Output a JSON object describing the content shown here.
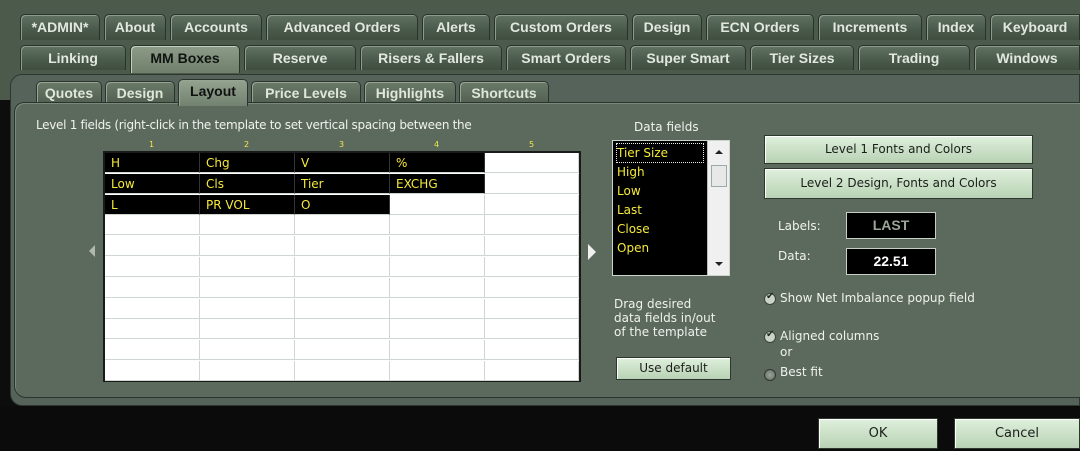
{
  "top_tabs_row1": [
    "*ADMIN*",
    "About",
    "Accounts",
    "Advanced Orders",
    "Alerts",
    "Custom Orders",
    "Design",
    "ECN Orders",
    "Increments",
    "Index",
    "Keyboard"
  ],
  "top_tabs_row2": [
    "Linking",
    "MM Boxes",
    "Reserve",
    "Risers & Fallers",
    "Smart Orders",
    "Super Smart",
    "Tier Sizes",
    "Trading",
    "Windows"
  ],
  "active_top_tab": "MM Boxes",
  "sub_tabs": [
    "Quotes",
    "Design",
    "Layout",
    "Price Levels",
    "Highlights",
    "Shortcuts"
  ],
  "active_sub_tab": "Layout",
  "caption": "Level 1 fields (right-click in the template to set vertical spacing between the",
  "column_numbers": [
    "1",
    "2",
    "3",
    "4",
    "5"
  ],
  "template_rows": [
    [
      "H",
      "Chg",
      "V",
      "%",
      ""
    ],
    [
      "Low",
      "Cls",
      "Tier",
      "EXCHG",
      ""
    ],
    [
      "L",
      "PR VOL",
      "O",
      "",
      ""
    ],
    [
      "",
      "",
      "",
      "",
      ""
    ],
    [
      "",
      "",
      "",
      "",
      ""
    ],
    [
      "",
      "",
      "",
      "",
      ""
    ],
    [
      "",
      "",
      "",
      "",
      ""
    ],
    [
      "",
      "",
      "",
      "",
      ""
    ],
    [
      "",
      "",
      "",
      "",
      ""
    ],
    [
      "",
      "",
      "",
      "",
      ""
    ],
    [
      "",
      "",
      "",
      "",
      ""
    ]
  ],
  "data_fields_title": "Data fields",
  "data_fields": [
    "Tier Size",
    "High",
    "Low",
    "Last",
    "Close",
    "Open"
  ],
  "drag_note_lines": [
    "Drag desired",
    "data fields in/out",
    "of the  template"
  ],
  "use_default_label": "Use default",
  "level1_button": "Level 1 Fonts and Colors",
  "level2_button": "Level 2 Design, Fonts and Colors",
  "labels_label": "Labels:",
  "labels_value": "LAST",
  "data_label": "Data:",
  "data_value": "22.51",
  "show_net_imbalance": "Show Net Imbalance popup field",
  "aligned_columns": "Aligned columns",
  "or_text": "or",
  "best_fit": "Best fit",
  "ok_label": "OK",
  "cancel_label": "Cancel",
  "colors": {
    "panel": "#5b6a5c",
    "field_text": "#f5ea3a",
    "button": "#c8e0c4"
  }
}
